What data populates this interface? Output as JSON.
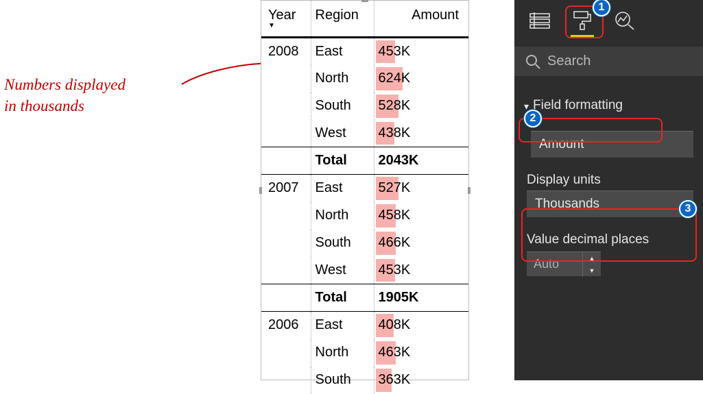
{
  "annotation": {
    "line1": "Numbers displayed",
    "line2": "in thousands"
  },
  "table": {
    "columns": {
      "year": "Year",
      "region": "Region",
      "amount": "Amount"
    },
    "total_label": "Total",
    "max_total": 2043,
    "groups": [
      {
        "year": "2008",
        "rows": [
          {
            "region": "East",
            "amount": "453K",
            "bar": 453
          },
          {
            "region": "North",
            "amount": "624K",
            "bar": 624
          },
          {
            "region": "South",
            "amount": "528K",
            "bar": 528
          },
          {
            "region": "West",
            "amount": "438K",
            "bar": 438
          }
        ],
        "total": "2043K"
      },
      {
        "year": "2007",
        "rows": [
          {
            "region": "East",
            "amount": "527K",
            "bar": 527
          },
          {
            "region": "North",
            "amount": "458K",
            "bar": 458
          },
          {
            "region": "South",
            "amount": "466K",
            "bar": 466
          },
          {
            "region": "West",
            "amount": "453K",
            "bar": 453
          }
        ],
        "total": "1905K"
      },
      {
        "year": "2006",
        "rows": [
          {
            "region": "East",
            "amount": "408K",
            "bar": 408
          },
          {
            "region": "North",
            "amount": "463K",
            "bar": 463
          },
          {
            "region": "South",
            "amount": "363K",
            "bar": 363
          }
        ],
        "total": ""
      }
    ]
  },
  "panel": {
    "search_placeholder": "Search",
    "section": "Field formatting",
    "field": "Amount",
    "display_units_label": "Display units",
    "display_units_value": "Thousands",
    "decimal_label": "Value decimal places",
    "decimal_value": "Auto"
  },
  "callouts": {
    "c1": "1",
    "c2": "2",
    "c3": "3"
  }
}
